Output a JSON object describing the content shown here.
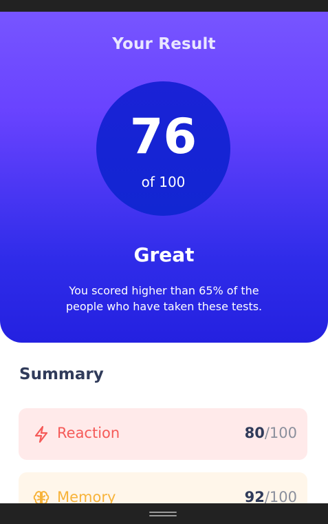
{
  "result": {
    "title": "Your Result",
    "score": "76",
    "total": "of 100",
    "rating": "Great",
    "description": "You scored higher than 65% of the people who have taken these tests."
  },
  "summary": {
    "title": "Summary",
    "items": [
      {
        "label": "Reaction",
        "score": "80",
        "max": "/100",
        "icon": "lightning-icon",
        "color": "#F55A58"
      },
      {
        "label": "Memory",
        "score": "92",
        "max": "/100",
        "icon": "brain-icon",
        "color": "#F7B33A"
      }
    ]
  }
}
